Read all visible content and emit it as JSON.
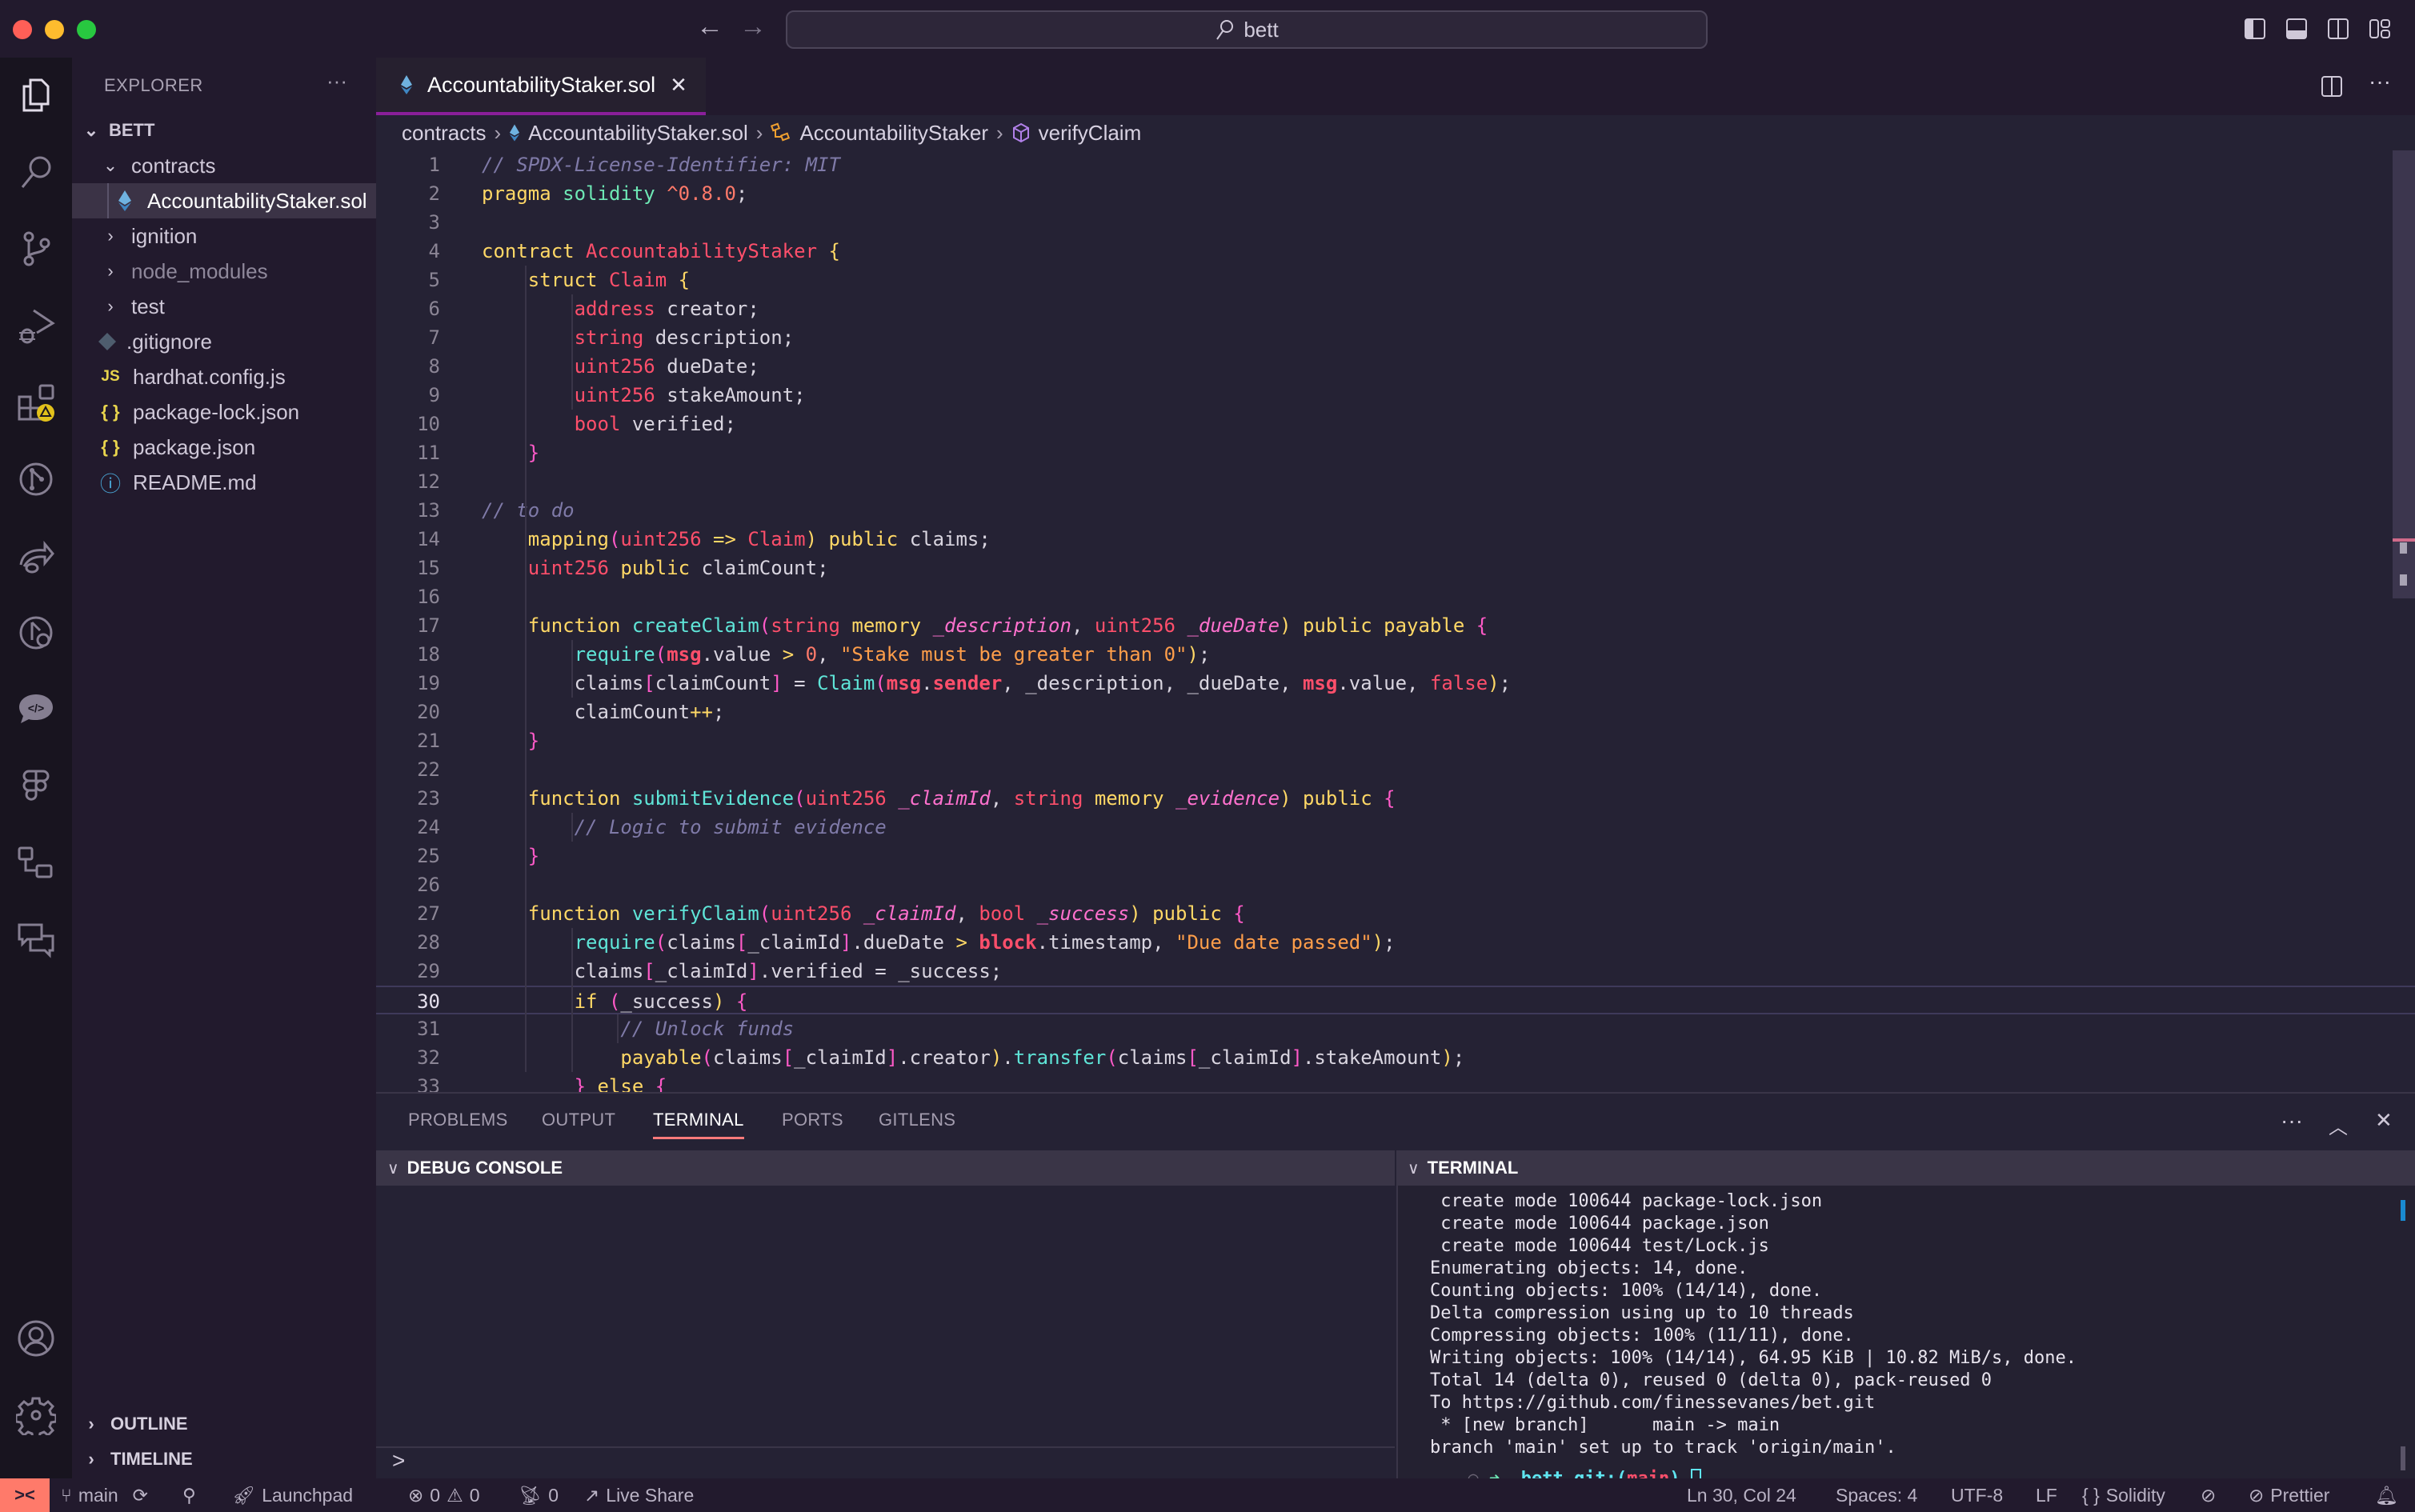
{
  "window": {
    "search_text": "bett",
    "traffic_lights": {
      "close": "#ff5f57",
      "minimize": "#febc2e",
      "maximize": "#28c840"
    }
  },
  "activity_bar": {
    "items": [
      {
        "name": "explorer-icon",
        "active": true
      },
      {
        "name": "search-icon"
      },
      {
        "name": "source-control-icon"
      },
      {
        "name": "run-debug-icon"
      },
      {
        "name": "extensions-icon",
        "badge": "warning"
      },
      {
        "name": "gitlens-icon"
      },
      {
        "name": "live-share-icon"
      },
      {
        "name": "gitlens-inspect-icon"
      },
      {
        "name": "code-chat-icon"
      },
      {
        "name": "figma-icon"
      },
      {
        "name": "remote-explorer-icon"
      },
      {
        "name": "comments-icon"
      }
    ],
    "bottom": [
      {
        "name": "account-icon"
      },
      {
        "name": "settings-gear-icon"
      }
    ]
  },
  "sidebar": {
    "title": "EXPLORER",
    "more": "···",
    "root": "BETT",
    "tree": [
      {
        "label": "contracts",
        "type": "folder",
        "expanded": true,
        "depth": 1
      },
      {
        "label": "AccountabilityStaker.sol",
        "type": "sol",
        "depth": 2,
        "selected": true
      },
      {
        "label": "ignition",
        "type": "folder",
        "expanded": false,
        "depth": 1
      },
      {
        "label": "node_modules",
        "type": "folder",
        "expanded": false,
        "depth": 1,
        "dimmed": true
      },
      {
        "label": "test",
        "type": "folder",
        "expanded": false,
        "depth": 1
      },
      {
        "label": ".gitignore",
        "type": "git",
        "depth": 1
      },
      {
        "label": "hardhat.config.js",
        "type": "js",
        "icon_text": "JS",
        "depth": 1
      },
      {
        "label": "package-lock.json",
        "type": "json",
        "icon_text": "{ }",
        "depth": 1
      },
      {
        "label": "package.json",
        "type": "json",
        "icon_text": "{ }",
        "depth": 1
      },
      {
        "label": "README.md",
        "type": "info",
        "icon_text": "ⓘ",
        "depth": 1
      }
    ],
    "sections": [
      "OUTLINE",
      "TIMELINE"
    ]
  },
  "editor": {
    "tab_label": "AccountabilityStaker.sol",
    "breadcrumb": [
      "contracts",
      "AccountabilityStaker.sol",
      "AccountabilityStaker",
      "verifyClaim"
    ],
    "current_line": 30,
    "lines": [
      "// SPDX-License-Identifier: MIT",
      "pragma solidity ^0.8.0;",
      "",
      "contract AccountabilityStaker {",
      "    struct Claim {",
      "        address creator;",
      "        string description;",
      "        uint256 dueDate;",
      "        uint256 stakeAmount;",
      "        bool verified;",
      "    }",
      "",
      "// to do",
      "    mapping(uint256 => Claim) public claims;",
      "    uint256 public claimCount;",
      "",
      "    function createClaim(string memory _description, uint256 _dueDate) public payable {",
      "        require(msg.value > 0, \"Stake must be greater than 0\");",
      "        claims[claimCount] = Claim(msg.sender, _description, _dueDate, msg.value, false);",
      "        claimCount++;",
      "    }",
      "",
      "    function submitEvidence(uint256 _claimId, string memory _evidence) public {",
      "        // Logic to submit evidence",
      "    }",
      "",
      "    function verifyClaim(uint256 _claimId, bool _success) public {",
      "        require(claims[_claimId].dueDate > block.timestamp, \"Due date passed\");",
      "        claims[_claimId].verified = _success;",
      "        if (_success) {",
      "            // Unlock funds",
      "            payable(claims[_claimId].creator).transfer(claims[_claimId].stakeAmount);",
      "        } else {"
    ]
  },
  "panel": {
    "tabs": [
      "PROBLEMS",
      "OUTPUT",
      "TERMINAL",
      "PORTS",
      "GITLENS"
    ],
    "active_tab": "TERMINAL",
    "debug_console_title": "DEBUG CONSOLE",
    "debug_prompt": ">",
    "terminal_title": "TERMINAL",
    "terminal_lines": [
      " create mode 100644 package-lock.json",
      " create mode 100644 package.json",
      " create mode 100644 test/Lock.js",
      "Enumerating objects: 14, done.",
      "Counting objects: 100% (14/14), done.",
      "Delta compression using up to 10 threads",
      "Compressing objects: 100% (11/11), done.",
      "Writing objects: 100% (14/14), 64.95 KiB | 10.82 MiB/s, done.",
      "Total 14 (delta 0), reused 0 (delta 0), pack-reused 0",
      "To https://github.com/finessevanes/bet.git",
      " * [new branch]      main -> main",
      "branch 'main' set up to track 'origin/main'."
    ],
    "prompt": {
      "arrow": "➜",
      "dir": "bett",
      "git_label": "git:(",
      "branch": "main",
      "close": ")"
    }
  },
  "status_bar": {
    "branch": "main",
    "launchpad": "Launchpad",
    "errors": "0",
    "warnings": "0",
    "ports": "0",
    "live_share": "Live Share",
    "cursor": "Ln 30, Col 24",
    "spaces": "Spaces: 4",
    "encoding": "UTF-8",
    "eol": "LF",
    "language": "Solidity",
    "formatter": "Prettier"
  }
}
